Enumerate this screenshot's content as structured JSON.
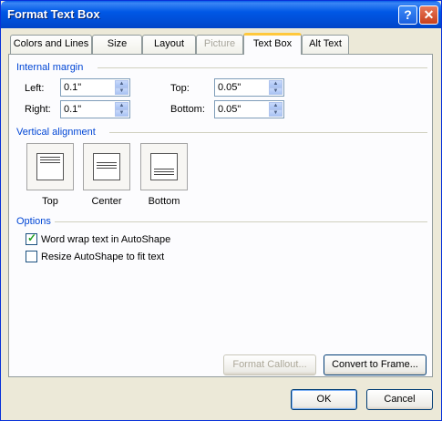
{
  "window": {
    "title": "Format Text Box"
  },
  "tabs": [
    {
      "label": "Colors and Lines",
      "state": "normal"
    },
    {
      "label": "Size",
      "state": "normal"
    },
    {
      "label": "Layout",
      "state": "normal"
    },
    {
      "label": "Picture",
      "state": "disabled"
    },
    {
      "label": "Text Box",
      "state": "active"
    },
    {
      "label": "Alt Text",
      "state": "normal"
    }
  ],
  "internal_margin": {
    "heading": "Internal margin",
    "left": {
      "label": "Left:",
      "value": "0.1\""
    },
    "right": {
      "label": "Right:",
      "value": "0.1\""
    },
    "top": {
      "label": "Top:",
      "value": "0.05\""
    },
    "bottom": {
      "label": "Bottom:",
      "value": "0.05\""
    }
  },
  "vertical_alignment": {
    "heading": "Vertical alignment",
    "options": [
      {
        "label": "Top"
      },
      {
        "label": "Center"
      },
      {
        "label": "Bottom"
      }
    ]
  },
  "options": {
    "heading": "Options",
    "word_wrap": {
      "label": "Word wrap text in AutoShape",
      "checked": true
    },
    "resize": {
      "label": "Resize AutoShape to fit text",
      "checked": false
    }
  },
  "buttons": {
    "format_callout": "Format Callout...",
    "convert_to_frame": "Convert to Frame...",
    "ok": "OK",
    "cancel": "Cancel"
  },
  "colors": {
    "title_bar": "#0058e6",
    "group_label": "#0046d5",
    "active_tab_accent": "#ffc83c",
    "checkmark": "#21a121"
  }
}
